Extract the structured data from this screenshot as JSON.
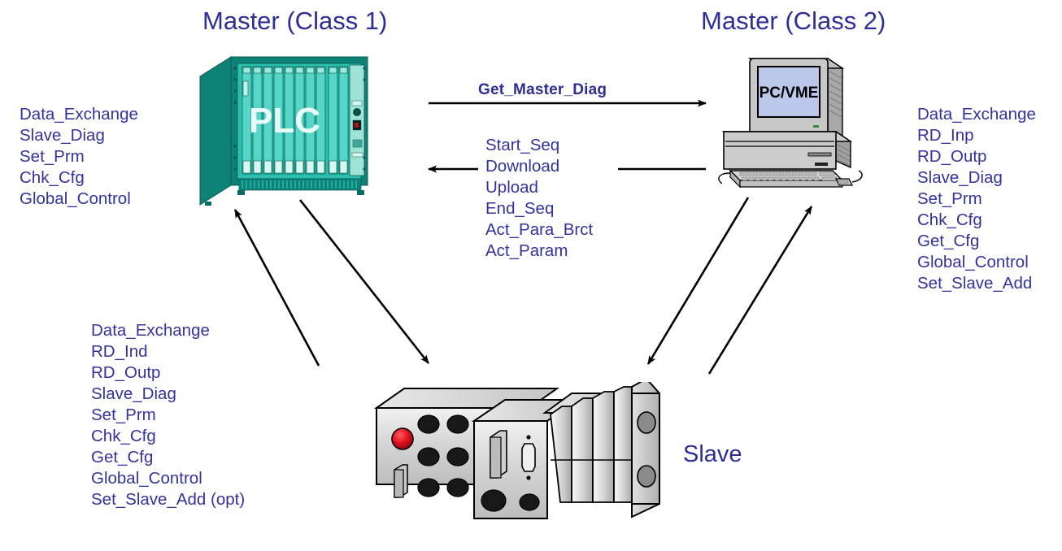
{
  "titles": {
    "master_class1": "Master (Class 1)",
    "master_class2": "Master (Class 2)"
  },
  "devices": {
    "plc": {
      "label": "PLC",
      "body_color": "#2bbfae",
      "side_color": "#0f8277",
      "dark_color": "#0a6c62"
    },
    "pc": {
      "label": "PC/VME",
      "case_color": "#c8c8c8",
      "screen_color": "#bcc8ea"
    },
    "slave": {
      "label": "Slave",
      "body_color": "#d4d4d4",
      "led_color": "#d81220"
    }
  },
  "arrows": {
    "get_master_diag": "Get_Master_Diag",
    "mid_services": [
      "Start_Seq",
      "Download",
      "Upload",
      "End_Seq",
      "Act_Para_Brct",
      "Act_Param"
    ]
  },
  "service_lists": {
    "class1_master": [
      "Data_Exchange",
      "Slave_Diag",
      "Set_Prm",
      "Chk_Cfg",
      "Global_Control"
    ],
    "class2_master": [
      "Data_Exchange",
      "RD_Inp",
      "RD_Outp",
      "Slave_Diag",
      "Set_Prm",
      "Chk_Cfg",
      "Get_Cfg",
      "Global_Control",
      "Set_Slave_Add"
    ],
    "slave_left": [
      "Data_Exchange",
      "RD_Ind",
      "RD_Outp",
      "Slave_Diag",
      "Set_Prm",
      "Chk_Cfg",
      "Get_Cfg",
      "Global_Control",
      "Set_Slave_Add (opt)"
    ]
  },
  "colors": {
    "text_blue": "#2e2e96",
    "list_blue": "#34339c",
    "line_black": "#000000"
  }
}
